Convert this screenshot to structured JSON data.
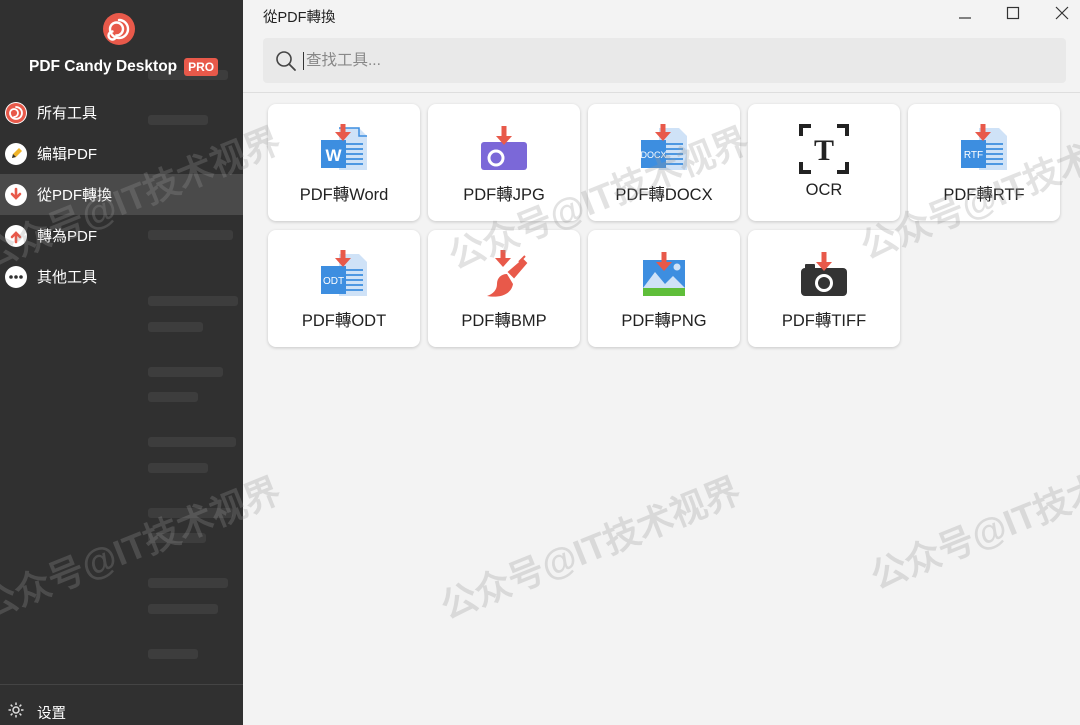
{
  "app": {
    "brand_name": "PDF Candy Desktop",
    "pro_badge": "PRO",
    "window_title": "從PDF轉換"
  },
  "sidebar": {
    "items": [
      {
        "label": "所有工具",
        "icon": "swirl-icon",
        "active": false
      },
      {
        "label": "编辑PDF",
        "icon": "pen-icon",
        "active": false
      },
      {
        "label": "從PDF轉換",
        "icon": "arrow-down-icon",
        "active": true
      },
      {
        "label": "轉為PDF",
        "icon": "arrow-up-icon",
        "active": false
      },
      {
        "label": "其他工具",
        "icon": "more-icon",
        "active": false
      }
    ],
    "settings_label": "设置"
  },
  "search": {
    "placeholder": "查找工具..."
  },
  "tools": [
    {
      "label": "PDF轉Word",
      "icon": "word-doc-icon",
      "badge": "W"
    },
    {
      "label": "PDF轉JPG",
      "icon": "jpg-camera-icon"
    },
    {
      "label": "PDF轉DOCX",
      "icon": "docx-doc-icon",
      "badge": "DOCX"
    },
    {
      "label": "OCR",
      "icon": "ocr-icon",
      "badge": "T"
    },
    {
      "label": "PDF轉RTF",
      "icon": "rtf-doc-icon",
      "badge": "RTF"
    },
    {
      "label": "PDF轉ODT",
      "icon": "odt-doc-icon",
      "badge": "ODT"
    },
    {
      "label": "PDF轉BMP",
      "icon": "bmp-brush-icon"
    },
    {
      "label": "PDF轉PNG",
      "icon": "png-image-icon"
    },
    {
      "label": "PDF轉TIFF",
      "icon": "tiff-camera-icon"
    }
  ],
  "watermark": "公众号@IT技术视界",
  "colors": {
    "accent": "#e8594a",
    "sidebar_bg": "#303030",
    "doc_blue": "#3d8ee0",
    "jpg_purple": "#7b68d8",
    "png_green": "#5fbe3a"
  }
}
